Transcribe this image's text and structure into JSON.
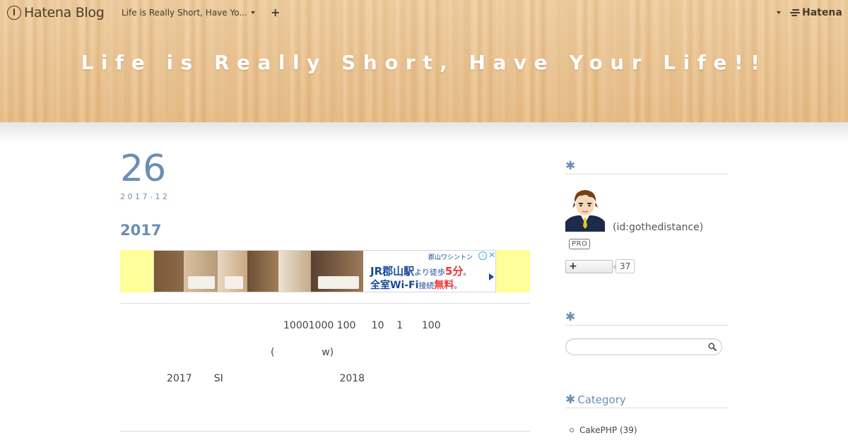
{
  "globalheader": {
    "logo_text": "Hatena Blog",
    "blog_select": "Life is Really Short, Have Yo...",
    "plus_label": "+",
    "brand": "Hatena"
  },
  "blog": {
    "title": "Life is Really Short, Have Your Life!!"
  },
  "entry": {
    "date_day": "26",
    "date_ym": "2017-12",
    "title": "2017",
    "body_lines": [
      "10001000 100     10    1      100",
      "(               w)",
      "2017       SI                                     2018"
    ],
    "ad": {
      "brand": "郡山ワシントン",
      "line1_a": "JR郡山駅",
      "line1_b": "より徒歩",
      "line1_c": "5分",
      "line1_d": "。",
      "line2_a": "全室Wi-Fi",
      "line2_b": "接続",
      "line2_c": "無料",
      "line2_d": "。",
      "info": "i",
      "close": "✕"
    }
  },
  "sidebar": {
    "profile": {
      "title": "",
      "id_text": "(id:gothedistance)",
      "pro": "PRO",
      "subscribe_label": "+",
      "subscribe_count": "37"
    },
    "search": {
      "title": "",
      "placeholder": ""
    },
    "category": {
      "title": "Category",
      "items": [
        {
          "label": "CakePHP (39)"
        }
      ]
    }
  },
  "colors": {
    "accent": "#6a8fb4",
    "header_wood": "#e9c08a",
    "ad_background": "#ffff99"
  }
}
